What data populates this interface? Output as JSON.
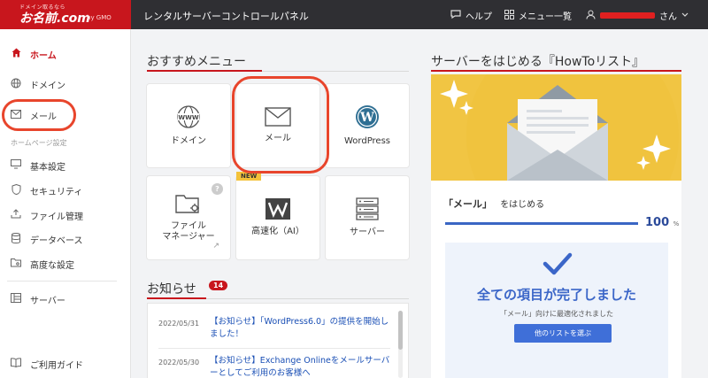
{
  "header": {
    "logo_tagline": "ドメイン取るなら",
    "logo_name": "お名前.com",
    "logo_sub": "by GMO",
    "app_title": "レンタルサーバーコントロールパネル",
    "help_label": "ヘルプ",
    "menu_list_label": "メニュー一覧",
    "user_suffix": "さん",
    "user_redacted_color": "#e02020"
  },
  "sidebar": {
    "items": [
      {
        "label": "ホーム",
        "icon": "home-icon"
      },
      {
        "label": "ドメイン",
        "icon": "globe-icon"
      },
      {
        "label": "メール",
        "icon": "mail-icon"
      }
    ],
    "section_label": "ホームページ設定",
    "hp_items": [
      {
        "label": "基本設定",
        "icon": "monitor-icon"
      },
      {
        "label": "セキュリティ",
        "icon": "shield-icon"
      },
      {
        "label": "ファイル管理",
        "icon": "upload-icon"
      },
      {
        "label": "データベース",
        "icon": "database-icon"
      },
      {
        "label": "高度な設定",
        "icon": "folder-gear-icon"
      }
    ],
    "server_label": "サーバー",
    "guide_label": "ご利用ガイド"
  },
  "recommended": {
    "title": "おすすめメニュー",
    "cards": [
      {
        "label": "ドメイン",
        "icon": "www-globe-icon"
      },
      {
        "label": "メール",
        "icon": "envelope-icon"
      },
      {
        "label": "WordPress",
        "icon": "wordpress-icon"
      },
      {
        "label": "ファイル\nマネージャー",
        "icon": "folder-gear-icon",
        "help": "?",
        "ext": "↗"
      },
      {
        "label": "高速化（AI）",
        "icon": "w-logo-icon",
        "badge": "NEW"
      },
      {
        "label": "サーバー",
        "icon": "server-icon"
      }
    ]
  },
  "news": {
    "title": "お知らせ",
    "count": "14",
    "items": [
      {
        "date": "2022/05/31",
        "title": "【お知らせ】「WordPress6.0」の提供を開始しました！"
      },
      {
        "date": "2022/05/30",
        "title": "【お知らせ】Exchange Onlineをメールサーバーとしてご利用のお客様へ"
      }
    ]
  },
  "howto": {
    "title": "サーバーをはじめる『HowToリスト』",
    "start_target": "「メール」",
    "start_suffix": "をはじめる",
    "progress_value": "100",
    "progress_unit": "%",
    "progress_fraction": 1.0,
    "done_title": "全ての項目が完了しました",
    "done_sub": "「メール」向けに最適化されました",
    "other_button": "他のリストを選ぶ"
  },
  "colors": {
    "brand_red": "#c8161d",
    "accent_blue": "#3b66c8",
    "hero_yellow": "#f1c543",
    "annotation_circle": "#e8452c"
  }
}
